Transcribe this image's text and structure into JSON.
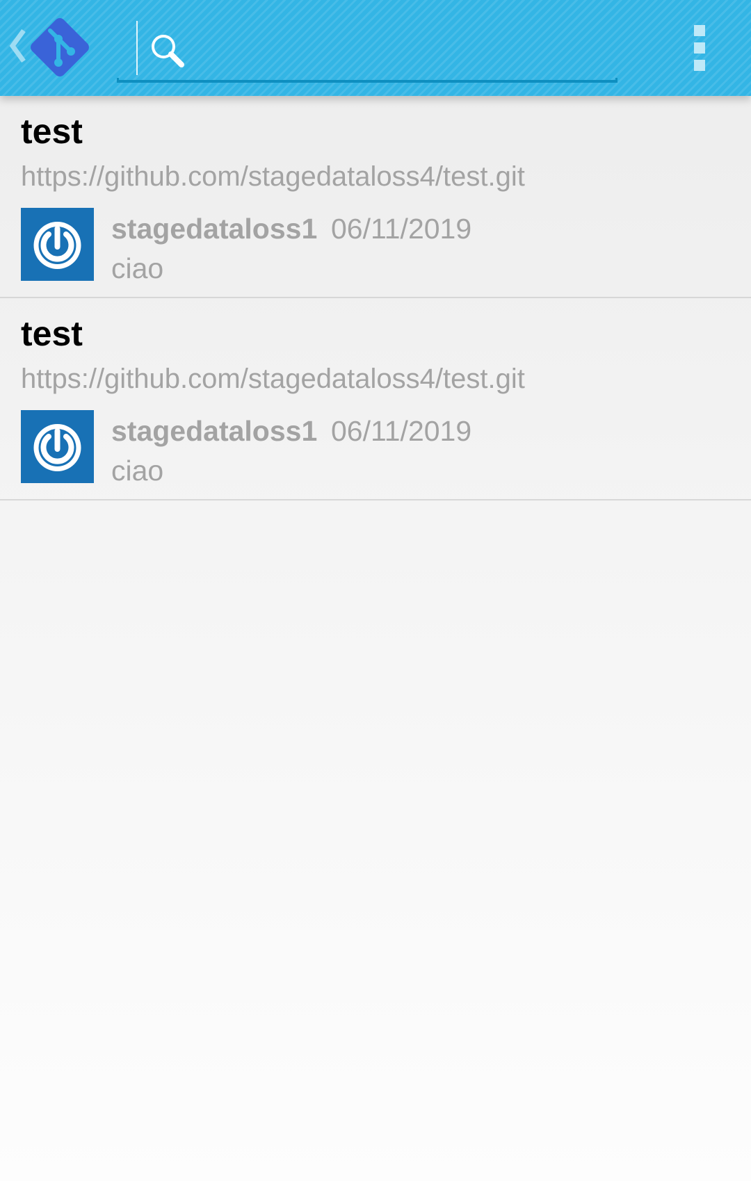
{
  "action_bar": {
    "background_color": "#33b5e5",
    "up_icon": "chevron-left-icon",
    "logo_icon": "git-logo-icon",
    "logo_color": "#3a63d8",
    "search": {
      "icon": "search-icon",
      "value": "",
      "placeholder": ""
    },
    "overflow_icon": "overflow-menu-icon"
  },
  "repositories": [
    {
      "name": "test",
      "url": "https://github.com/stagedataloss4/test.git",
      "avatar_color": "#1871b5",
      "avatar_icon": "power-icon",
      "last_commit": {
        "author": "stagedataloss1",
        "date": "06/11/2019",
        "message": "ciao"
      }
    },
    {
      "name": "test",
      "url": "https://github.com/stagedataloss4/test.git",
      "avatar_color": "#1871b5",
      "avatar_icon": "power-icon",
      "last_commit": {
        "author": "stagedataloss1",
        "date": "06/11/2019",
        "message": "ciao"
      }
    }
  ]
}
